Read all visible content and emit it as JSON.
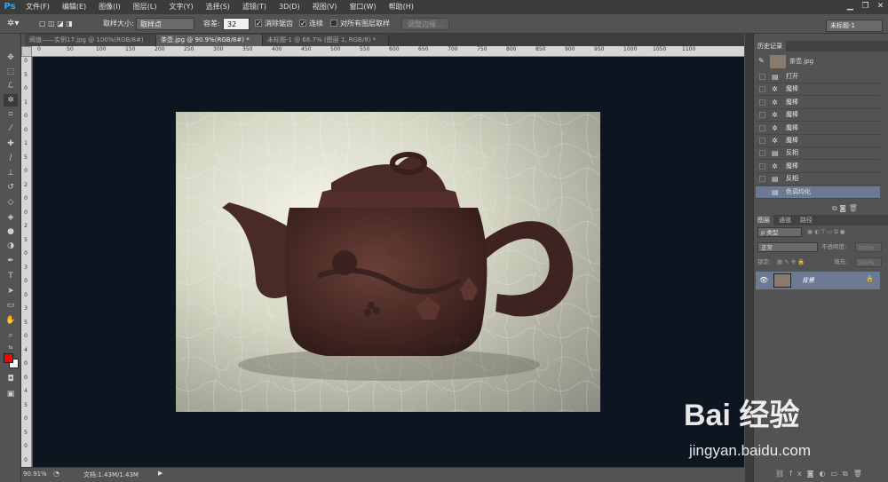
{
  "app": {
    "logo": "Ps",
    "menu": [
      "文件(F)",
      "编辑(E)",
      "图像(I)",
      "图层(L)",
      "文字(Y)",
      "选择(S)",
      "滤镜(T)",
      "3D(D)",
      "视图(V)",
      "窗口(W)",
      "帮助(H)"
    ],
    "window_controls": [
      "▁",
      "❐",
      "✕"
    ]
  },
  "options_bar": {
    "sample_size_label": "取样大小:",
    "sample_size_value": "取样点",
    "tolerance_label": "容差:",
    "tolerance_value": "32",
    "antialias_label": "消除锯齿",
    "contiguous_label": "连续",
    "all_layers_label": "对所有图层取样",
    "refine_edge_label": "调整边缘...",
    "workspace_value": "未标题-1"
  },
  "tabs": [
    {
      "label": "阀值——实例17.jpg @ 100%(RGB/8#)",
      "active": false
    },
    {
      "label": "茶壶.jpg @ 90.9%(RGB/8#) *",
      "active": true
    },
    {
      "label": "未标题-1 @ 66.7% (图层 1, RGB/8) *",
      "active": false
    }
  ],
  "ruler_top": [
    "0",
    "50",
    "100",
    "150",
    "200",
    "250",
    "300",
    "350",
    "400",
    "450",
    "500",
    "550",
    "600",
    "650",
    "700",
    "750",
    "800",
    "850",
    "900",
    "950",
    "1000",
    "1050",
    "1100"
  ],
  "ruler_left": [
    "0",
    "5",
    "0",
    "1",
    "0",
    "0",
    "1",
    "5",
    "0",
    "2",
    "0",
    "0",
    "2",
    "5",
    "0",
    "3",
    "0",
    "0",
    "3",
    "5",
    "0",
    "4",
    "0",
    "0",
    "4",
    "5",
    "0",
    "5",
    "0",
    "0"
  ],
  "status": {
    "zoom": "90.91%",
    "doc_info": "文档:1.43M/1.43M"
  },
  "history": {
    "title": "历史记录",
    "snapshot_name": "茶壶.jpg",
    "items": [
      {
        "label": "打开",
        "selected": false
      },
      {
        "label": "魔棒",
        "selected": false
      },
      {
        "label": "魔棒",
        "selected": false
      },
      {
        "label": "魔棒",
        "selected": false
      },
      {
        "label": "魔棒",
        "selected": false
      },
      {
        "label": "魔棒",
        "selected": false
      },
      {
        "label": "反相",
        "selected": false
      },
      {
        "label": "魔棒",
        "selected": false
      },
      {
        "label": "反相",
        "selected": false
      },
      {
        "label": "色调均化",
        "selected": true
      }
    ]
  },
  "layers_panel": {
    "tabs": [
      "图层",
      "通道",
      "路径"
    ],
    "kind_label": "ρ 类型",
    "blend_mode": "正常",
    "opacity_label": "不透明度:",
    "opacity_value": "100%",
    "lock_label": "锁定:",
    "fill_label": "填充:",
    "fill_value": "100%",
    "layer_name": "背景"
  },
  "watermark": {
    "brand": "Bai 经验",
    "url": "jingyan.baidu.com"
  },
  "colors": {
    "foreground": "#ff0000",
    "background": "#ffffff",
    "canvas_bg": "#0d1520",
    "selection": "#6b7a92"
  }
}
